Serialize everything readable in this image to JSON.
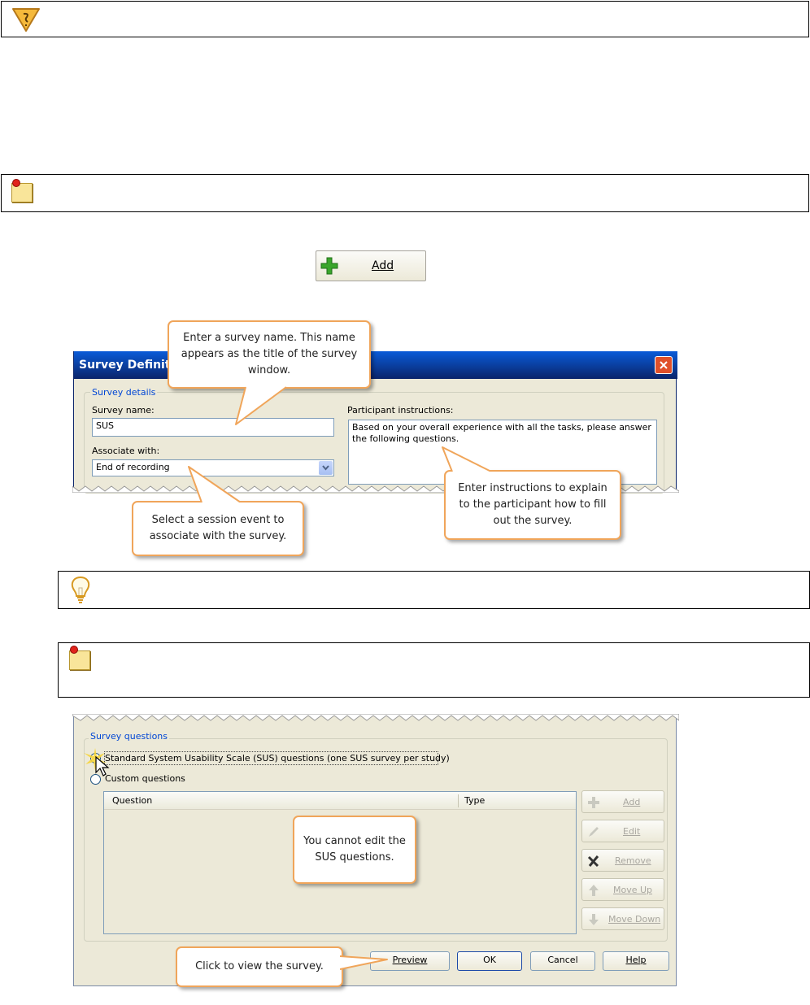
{
  "add_button": {
    "label": "Add"
  },
  "dialog1": {
    "title": "Survey Definitio",
    "group_title": "Survey details",
    "name_label": "Survey name:",
    "name_value": "SUS",
    "associate_label": "Associate with:",
    "associate_value": "End of recording",
    "instructions_label": "Participant instructions:",
    "instructions_value": "Based on your overall experience with all the tasks, please answer the following questions."
  },
  "callouts": {
    "survey_name": "Enter a survey name. This name appears as the title of the survey window.",
    "session_event": "Select a session event to associate with the survey.",
    "instructions": "Enter instructions to explain to the participant how to fill out the survey.",
    "cannot_edit": "You cannot edit the SUS questions.",
    "preview": "Click to view the survey."
  },
  "dialog2": {
    "group_title": "Survey questions",
    "option_sus": "Standard System Usability Scale (SUS) questions (one SUS survey per study)",
    "option_custom": "Custom questions",
    "columns": [
      "Question",
      "Type"
    ],
    "side_buttons": [
      "Add",
      "Edit",
      "Remove",
      "Move Up",
      "Move Down"
    ],
    "bottom_buttons": [
      "Preview",
      "OK",
      "Cancel",
      "Help"
    ]
  },
  "icons": {
    "warning": "warning-icon",
    "note": "sticky-note-icon",
    "tip": "lightbulb-icon",
    "plus": "plus-icon",
    "close": "close-icon",
    "dropdown": "chevron-down-icon",
    "cursor": "mouse-cursor-icon"
  },
  "colors": {
    "callout_border": "#f0a55a",
    "xp_title": "#0a246a",
    "group_title": "#0046d5",
    "dialog_bg": "#ece9d8",
    "plus_green": "#3aa52c"
  }
}
